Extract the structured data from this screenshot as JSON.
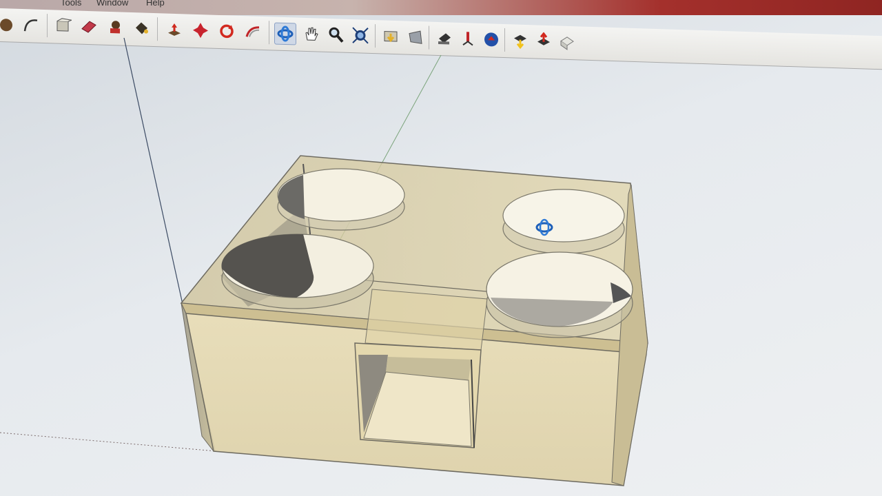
{
  "menu": {
    "items": [
      "Tools",
      "Window",
      "Help"
    ]
  },
  "toolbar": {
    "buttons": [
      {
        "name": "paint-bucket",
        "icon": "paint-bucket-icon"
      },
      {
        "name": "arc",
        "icon": "arc-icon"
      },
      {
        "name": "select",
        "icon": "select-icon"
      },
      {
        "name": "eraser",
        "icon": "eraser-icon"
      },
      {
        "name": "tape-measure",
        "icon": "tape-measure-icon"
      },
      {
        "name": "paint",
        "icon": "paint-icon"
      },
      {
        "name": "push-pull",
        "icon": "push-pull-icon"
      },
      {
        "name": "move",
        "icon": "move-icon"
      },
      {
        "name": "rotate",
        "icon": "rotate-icon"
      },
      {
        "name": "follow-me",
        "icon": "follow-me-icon"
      },
      {
        "name": "orbit",
        "icon": "orbit-icon",
        "active": true
      },
      {
        "name": "pan",
        "icon": "pan-hand-icon"
      },
      {
        "name": "zoom",
        "icon": "zoom-icon"
      },
      {
        "name": "zoom-extents",
        "icon": "zoom-extents-icon"
      },
      {
        "name": "previous-view",
        "icon": "previous-view-icon"
      },
      {
        "name": "next-view",
        "icon": "next-view-icon"
      },
      {
        "name": "position-camera",
        "icon": "position-camera-icon"
      },
      {
        "name": "walk",
        "icon": "walk-icon"
      },
      {
        "name": "look-around",
        "icon": "look-around-icon"
      },
      {
        "name": "get-models",
        "icon": "get-models-icon"
      },
      {
        "name": "share-model",
        "icon": "share-model-icon"
      },
      {
        "name": "share-component",
        "icon": "share-component-icon"
      }
    ]
  },
  "colors": {
    "box_fill": "#e3d6a8",
    "box_edge": "#6d6a60",
    "toolbar_bg": "#eeeeec",
    "title_red": "#a4302c"
  }
}
